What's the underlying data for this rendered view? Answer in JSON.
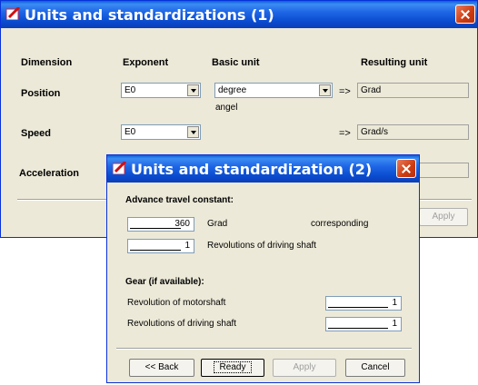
{
  "win1": {
    "title": "Units and standardizations (1)",
    "headers": {
      "dimension": "Dimension",
      "exponent": "Exponent",
      "basic_unit": "Basic unit",
      "resulting_unit": "Resulting unit"
    },
    "rows": [
      {
        "label": "Position",
        "exponent": "E0",
        "basic_unit": "degree",
        "basic_unit_note": "angel",
        "arrow": "=>",
        "result": "Grad"
      },
      {
        "label": "Speed",
        "exponent": "E0",
        "arrow": "=>",
        "result": "Grad/s"
      },
      {
        "label": "Acceleration"
      }
    ],
    "apply_label": "Apply"
  },
  "win2": {
    "title": "Units and standardization (2)",
    "advance_heading": "Advance travel constant:",
    "grad_value": "360",
    "grad_label": "Grad",
    "corresponding": "corresponding",
    "rev_value": "1",
    "rev_label": "Revolutions of driving shaft",
    "gear_heading": "Gear (if available):",
    "motor_label": "Revolution of motorshaft",
    "motor_value": "1",
    "driving_label": "Revolutions of driving shaft",
    "driving_value": "1",
    "buttons": {
      "back": "<< Back",
      "ready": "Ready",
      "apply": "Apply",
      "cancel": "Cancel"
    }
  },
  "colors": {
    "titlebar": "#0a4cd0",
    "face": "#ece9d8",
    "close": "#cc3b10"
  }
}
